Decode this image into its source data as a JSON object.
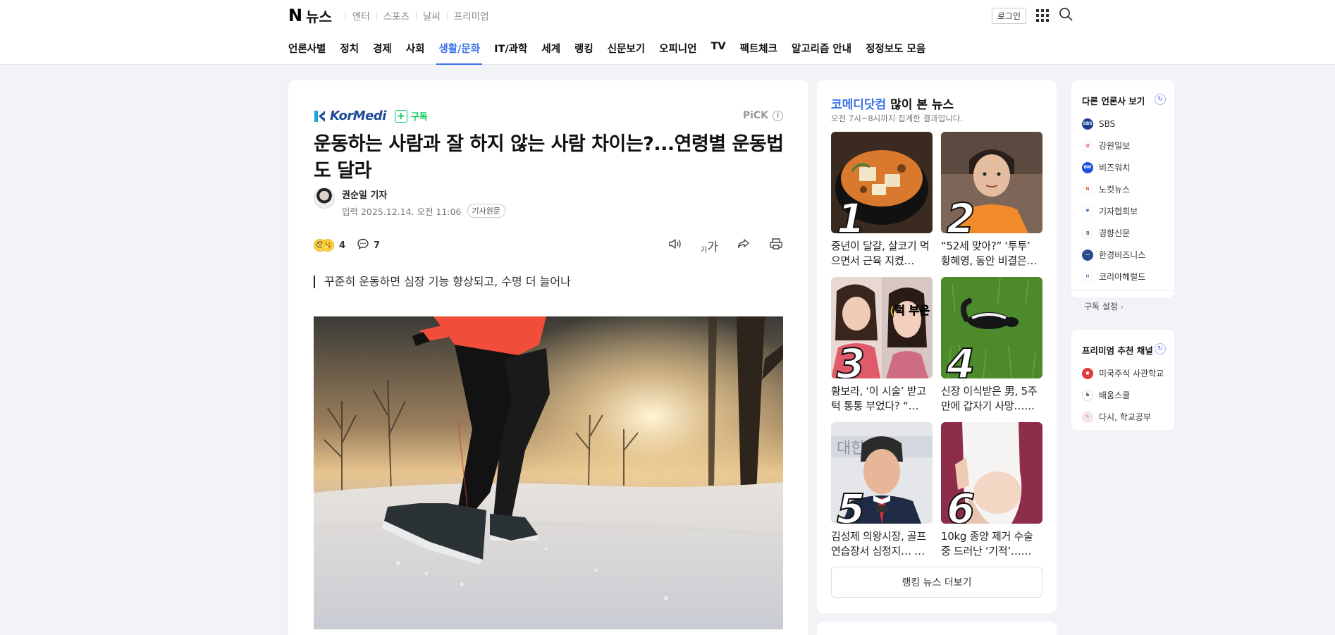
{
  "header": {
    "logo": "N",
    "service": "뉴스",
    "top_links": [
      "엔터",
      "스포츠",
      "날씨",
      "프리미엄"
    ],
    "login": "로그인"
  },
  "nav": [
    "언론사별",
    "정치",
    "경제",
    "사회",
    "생활/문화",
    "IT/과학",
    "세계",
    "랭킹",
    "신문보기",
    "오피니언",
    "TV",
    "팩트체크",
    "알고리즘 안내",
    "정정보도 모음"
  ],
  "nav_active_index": 4,
  "article": {
    "press_logo": "KorMedi",
    "subscribe": "구독",
    "pick": "PiCK",
    "headline": "운동하는 사람과 잘 하지 않는 사람 차이는?...연령별 운동법도 달라",
    "reporter": "권순일 기자",
    "date": "입력 2025.12.14. 오전 11:06",
    "original_btn": "기사원문",
    "reaction_count": "4",
    "comment_count": "7",
    "font_size_label": "가",
    "subhead": "꾸준히 운동하면 심장 기능 향상되고, 수명 더 늘어나"
  },
  "ranking": {
    "brand": "코메디닷컴",
    "title_rest": " 많이 본 뉴스",
    "subtitle": "오전 7시~8시까지 집계한 결과입니다.",
    "items": [
      {
        "rank": "1",
        "text": "중년이 달걀, 살코기 먹으면서 근육 지켰…"
      },
      {
        "rank": "2",
        "text": "“52세 맞아?” ‘투투’ 황혜영, 동안 비결은…"
      },
      {
        "rank": "3",
        "text": "황보라, ‘이 시술’ 받고 턱 통통 부었다? “…"
      },
      {
        "rank": "4",
        "text": "신장 이식받은 男, 5주 만에 갑자기 사망……"
      },
      {
        "rank": "5",
        "text": "김성제 의왕시장, 골프 연습장서 심정지… …"
      },
      {
        "rank": "6",
        "text": "10kg 종양 제거 수술 중 드러난 ‘기적’……"
      }
    ],
    "thumb_text_3": "(턱 부은",
    "more": "랭킹 뉴스 더보기"
  },
  "other_press": {
    "title": "다른 언론사 보기",
    "items": [
      {
        "name": "SBS",
        "color": "#1d3f8f"
      },
      {
        "name": "강원일보",
        "color": "#d94b4b"
      },
      {
        "name": "비즈워치",
        "color": "#1e4fd8"
      },
      {
        "name": "노컷뉴스",
        "color": "#e0582b"
      },
      {
        "name": "기자협회보",
        "color": "#3a6fb5"
      },
      {
        "name": "경향신문",
        "color": "#555555"
      },
      {
        "name": "한경비즈니스",
        "color": "#2a4c8d"
      },
      {
        "name": "코리아헤럴드",
        "color": "#6a8fc4"
      }
    ],
    "setting": "구독 설정"
  },
  "premium": {
    "title": "프리미엄 추천 채널",
    "items": [
      {
        "name": "미국주식 사관학교",
        "color": "#e03a3a"
      },
      {
        "name": "배움스쿨",
        "color": "#222222"
      },
      {
        "name": "다시, 학교공부",
        "color": "#d6a0a0"
      }
    ]
  },
  "accent": "#3d72e8",
  "subscribe_color": "#03c75a"
}
